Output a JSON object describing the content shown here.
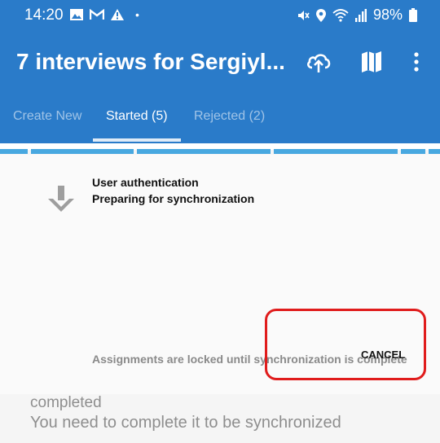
{
  "status_bar": {
    "time": "14:20",
    "battery": "98%",
    "left_icons": [
      "image-icon",
      "gmail-icon",
      "warning-icon",
      "dot-icon"
    ],
    "right_icons": [
      "mute-icon",
      "location-icon",
      "wifi-icon",
      "signal-icon",
      "battery-icon"
    ]
  },
  "app_bar": {
    "title": "7 interviews for Sergiyl...",
    "actions": [
      "cloud-sync-icon",
      "map-icon",
      "more-vert-icon"
    ]
  },
  "tabs": [
    {
      "label": "Create New",
      "active": false
    },
    {
      "label": "Started (5)",
      "active": true
    },
    {
      "label": "Rejected (2)",
      "active": false
    }
  ],
  "dialog": {
    "icon": "download-arrow-icon",
    "status_line1": "User authentication",
    "status_line2": "Preparing for synchronization",
    "note": "Assignments are locked until synchronization is complete",
    "cancel_label": "CANCEL"
  },
  "list_below": {
    "line1": "completed",
    "line2": "You need to complete it to be synchronized"
  },
  "colors": {
    "primary": "#2a7bc9",
    "strip": "#48a8e0",
    "highlight": "#e01c1c"
  }
}
